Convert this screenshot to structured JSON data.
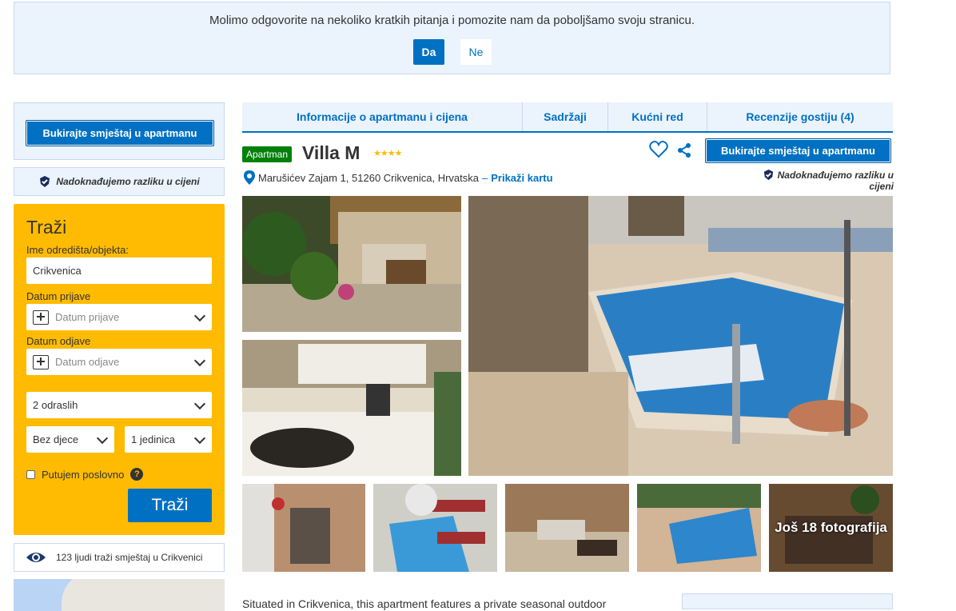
{
  "survey": {
    "question": "Molimo odgovorite na nekoliko kratkih pitanja i pomozite nam da poboljšamo svoju stranicu.",
    "yes": "Da",
    "no": "Ne"
  },
  "sidebar": {
    "book_button": "Bukirajte smještaj u apartmanu",
    "price_match": "Nadoknađujemo razliku u cijeni",
    "search": {
      "title": "Traži",
      "destination_label": "Ime odredišta/objekta:",
      "destination_value": "Crikvenica",
      "checkin_label": "Datum prijave",
      "checkin_placeholder": "Datum prijave",
      "checkout_label": "Datum odjave",
      "checkout_placeholder": "Datum odjave",
      "adults": "2 odraslih",
      "children": "Bez djece",
      "rooms": "1 jedinica",
      "business_label": "Putujem poslovno",
      "submit": "Traži"
    },
    "looking_text": "123 ljudi traži smještaj u Crikvenici"
  },
  "tabs": [
    {
      "label": "Informacije o apartmanu i cijena"
    },
    {
      "label": "Sadržaji"
    },
    {
      "label": "Kućni red"
    },
    {
      "label": "Recenzije gostiju (4)"
    }
  ],
  "property": {
    "type_badge": "Apartman",
    "name": "Villa M",
    "stars": "★★★★",
    "star_count": 4,
    "address": "Marušićev Zajam 1, 51260 Crikvenica, Hrvatska",
    "address_sep": "–",
    "map_link": "Prikaži kartu",
    "book_button": "Bukirajte smještaj u apartmanu",
    "price_match": "Nadoknađujemo razliku u cijeni"
  },
  "gallery": {
    "more_photos": "Još 18 fotografija"
  },
  "description_start": "Situated in Crikvenica, this apartment features a private seasonal outdoor",
  "colors": {
    "brand_blue": "#0071c2",
    "search_yellow": "#febb02",
    "badge_green": "#008009",
    "light_blue_bg": "#ebf3fc"
  }
}
